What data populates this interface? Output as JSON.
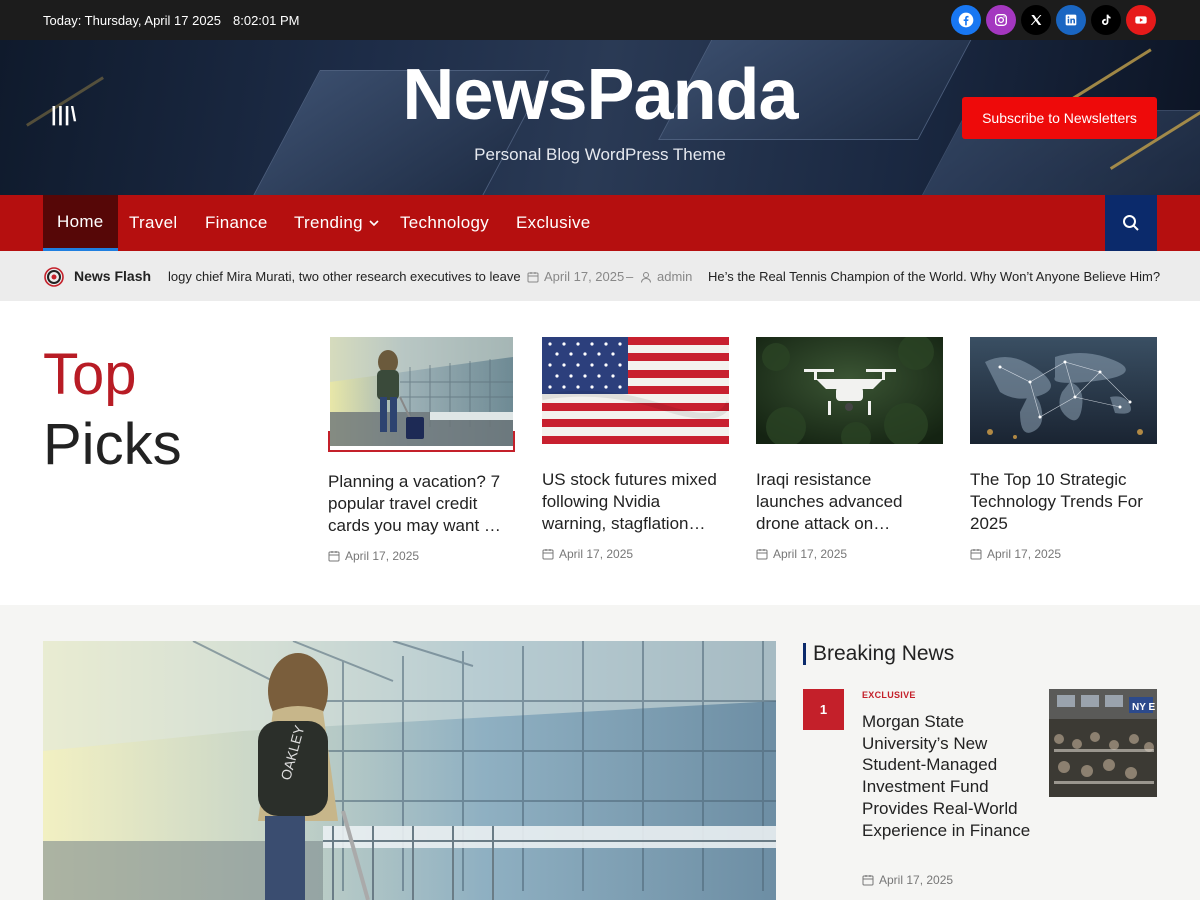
{
  "topbar": {
    "date": "Today: Thursday, April 17 2025",
    "time": "8:02:01 PM",
    "social": [
      {
        "icon": "facebook-icon",
        "color": "#1877f2"
      },
      {
        "icon": "instagram-icon",
        "color": "#a437c0"
      },
      {
        "icon": "x-icon",
        "color": "#000000"
      },
      {
        "icon": "linkedin-icon",
        "color": "#1a66c2"
      },
      {
        "icon": "tiktok-icon",
        "color": "#000000"
      },
      {
        "icon": "youtube-icon",
        "color": "#e61a1a"
      }
    ]
  },
  "header": {
    "title": "NewsPanda",
    "subtitle": "Personal Blog WordPress Theme",
    "menu_icon": "|||\\",
    "subscribe_label": "Subscribe to Newsletters"
  },
  "nav": {
    "items": [
      {
        "label": "Home",
        "active": true
      },
      {
        "label": "Travel"
      },
      {
        "label": "Finance"
      },
      {
        "label": "Trending",
        "has_dropdown": true
      },
      {
        "label": "Technology"
      },
      {
        "label": "Exclusive"
      }
    ],
    "search_icon": "search-icon"
  },
  "flash": {
    "label": "News Flash",
    "item1": "logy chief Mira Murati, two other research executives to leave",
    "date": "April 17, 2025",
    "author": "admin",
    "item2": "He’s the Real Tennis Champion of the World. Why Won’t Anyone Believe Him?"
  },
  "top_picks": {
    "heading_line1": "Top",
    "heading_line2": "Picks",
    "cards": [
      {
        "title": "Planning a vacation? 7 popular travel credit cards you may want …",
        "date": "April 17, 2025"
      },
      {
        "title": "US stock futures mixed following Nvidia warning, stagflation…",
        "date": "April 17, 2025"
      },
      {
        "title": "Iraqi resistance launches advanced drone attack on…",
        "date": "April 17, 2025"
      },
      {
        "title": "The Top 10 Strategic Technology Trends For 2025",
        "date": "April 17, 2025"
      }
    ]
  },
  "breaking": {
    "heading": "Breaking News",
    "items": [
      {
        "rank": "1",
        "category": "EXCLUSIVE",
        "title": "Morgan State University’s New Student-Managed Investment Fund Provides Real-World Experience in Finance",
        "date": "April 17, 2025"
      }
    ]
  },
  "colors": {
    "accent_red": "#b50f0f",
    "dark_red": "#560707",
    "navy": "#0b2a6b",
    "title_red": "#b81c25"
  }
}
